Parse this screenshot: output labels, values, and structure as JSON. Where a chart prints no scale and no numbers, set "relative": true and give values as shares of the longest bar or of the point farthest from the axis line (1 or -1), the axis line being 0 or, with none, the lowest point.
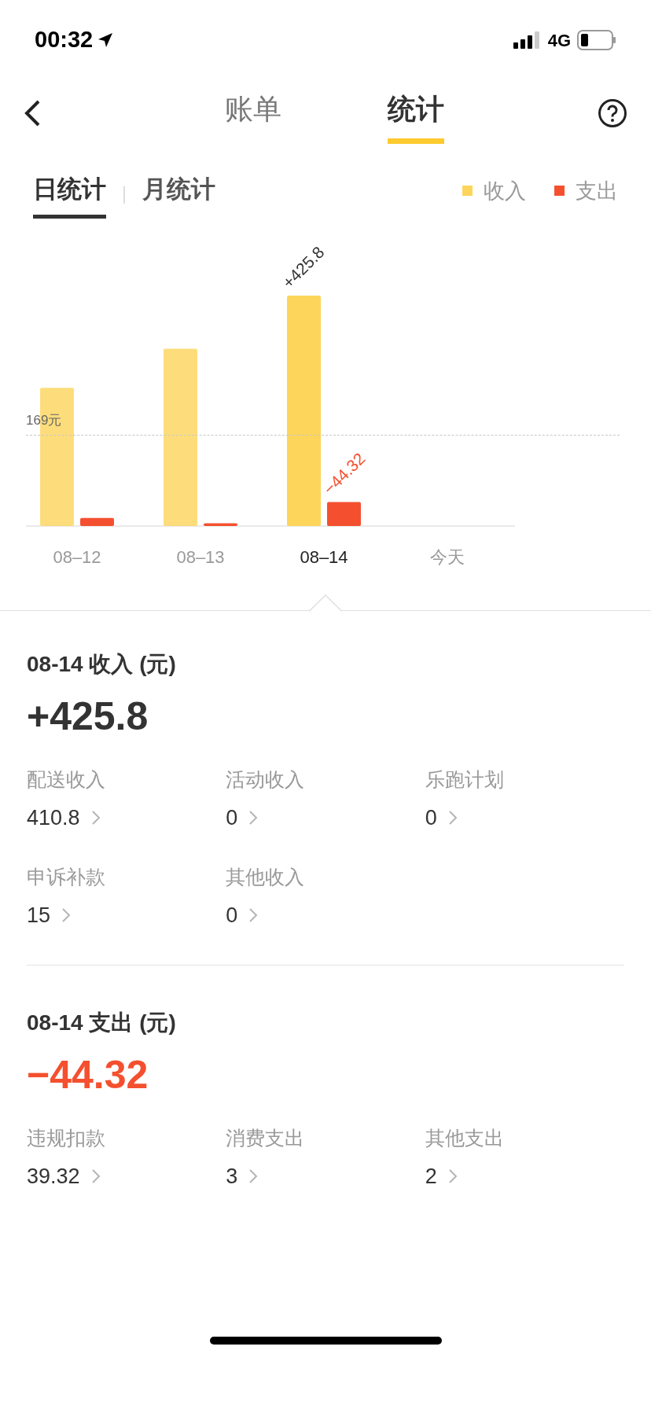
{
  "status_bar": {
    "time": "00:32",
    "network": "4G"
  },
  "nav": {
    "tabs": [
      {
        "label": "账单",
        "selected": false
      },
      {
        "label": "统计",
        "selected": true
      }
    ]
  },
  "period_tabs": [
    {
      "label": "日统计",
      "selected": true
    },
    {
      "label": "月统计",
      "selected": false
    }
  ],
  "chart": {
    "day_selected": [
      false,
      false,
      true,
      false
    ],
    "reference_label": "169元",
    "chart_data": {
      "type": "bar",
      "categories": [
        "08–12",
        "08–13",
        "08–14",
        "今天"
      ],
      "series": [
        {
          "name": "收入",
          "color": "#fdd55a",
          "values": [
            0.6,
            0.77,
            1,
            null
          ]
        },
        {
          "name": "支出",
          "color": "#f4502f",
          "values": [
            0.035,
            0.012,
            0.104,
            null
          ]
        }
      ],
      "relative": true,
      "annotations": [
        {
          "text": "+425.8",
          "x": "08–14",
          "y": 1
        },
        {
          "text": "−44.32",
          "x": "08–14",
          "y": 0.104
        }
      ]
    }
  },
  "sections": [
    {
      "kind": "income",
      "title": "08-14 收入 (元)",
      "amount": "+425.8",
      "items": [
        {
          "label": "配送收入",
          "value": "410.8"
        },
        {
          "label": "活动收入",
          "value": "0"
        },
        {
          "label": "乐跑计划",
          "value": "0"
        },
        {
          "label": "申诉补款",
          "value": "15"
        },
        {
          "label": "其他收入",
          "value": "0"
        }
      ]
    },
    {
      "kind": "expense",
      "title": "08-14 支出 (元)",
      "amount": "−44.32",
      "items": [
        {
          "label": "违规扣款",
          "value": "39.32"
        },
        {
          "label": "消费支出",
          "value": "3"
        },
        {
          "label": "其他支出",
          "value": "2"
        }
      ]
    }
  ]
}
